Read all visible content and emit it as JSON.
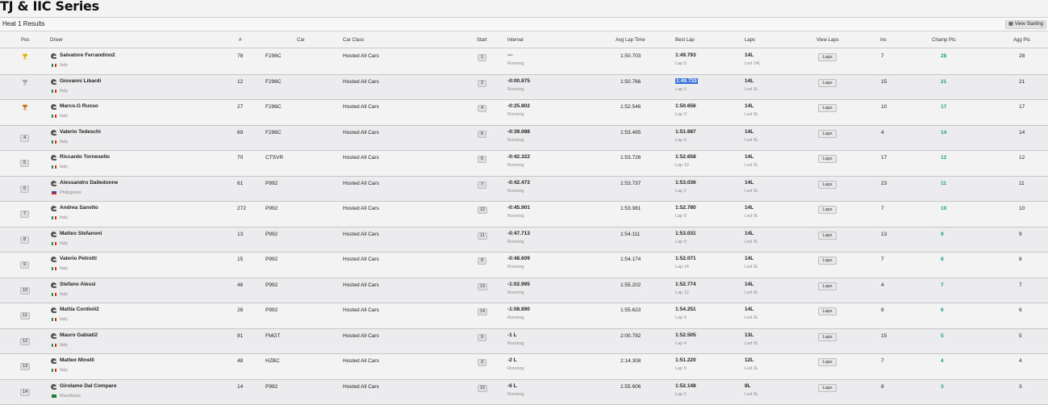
{
  "page": {
    "title": "TJ & IIC Series",
    "heat": "Heat 1 Results",
    "view_starting": "View Starting",
    "laps_button": "Laps"
  },
  "headers": [
    "Pos",
    "Driver",
    "#",
    "Car",
    "Car Class",
    "Start",
    "Interval",
    "Avg Lap Time",
    "Best Lap",
    "Laps",
    "View Laps",
    "Inc",
    "Champ Pts",
    "Agg Pts"
  ],
  "rows": [
    {
      "pos": "1",
      "trophy": "gold",
      "driver": "Salvatore Ferrandino2",
      "flag": "it",
      "country": "Italy",
      "num": "78",
      "car": "F296C",
      "car_class": "Hosted All Cars",
      "start": "1",
      "interval": "---",
      "status": "Running",
      "avg": "1:50.703",
      "best": "1:49.793",
      "best_lap": "Lap 5",
      "laps": "14L",
      "led": "Led 14L",
      "inc": "7",
      "champ": "28",
      "agg": "28"
    },
    {
      "pos": "2",
      "trophy": "silver",
      "driver": "Giovanni Libardi",
      "flag": "it",
      "country": "Italy",
      "num": "12",
      "car": "F296C",
      "car_class": "Hosted All Cars",
      "start": "2",
      "interval": "-0:00.875",
      "status": "Running",
      "avg": "1:50.766",
      "best": "1:49.733",
      "best_lap": "Lap 5",
      "laps": "14L",
      "led": "Led 0L",
      "inc": "15",
      "champ": "21",
      "agg": "21",
      "highlight": true
    },
    {
      "pos": "3",
      "trophy": "bronze",
      "driver": "Marco.G Russo",
      "flag": "it",
      "country": "Italy",
      "num": "27",
      "car": "F296C",
      "car_class": "Hosted All Cars",
      "start": "4",
      "interval": "-0:25.802",
      "status": "Running",
      "avg": "1:52.546",
      "best": "1:50.656",
      "best_lap": "Lap 9",
      "laps": "14L",
      "led": "Led 0L",
      "inc": "10",
      "champ": "17",
      "agg": "17"
    },
    {
      "pos": "4",
      "driver": "Valerio Tedeschi",
      "flag": "it",
      "country": "Italy",
      "num": "69",
      "car": "F296C",
      "car_class": "Hosted All Cars",
      "start": "6",
      "interval": "-0:39.088",
      "status": "Running",
      "avg": "1:53.495",
      "best": "1:51.687",
      "best_lap": "Lap 6",
      "laps": "14L",
      "led": "Led 0L",
      "inc": "4",
      "champ": "14",
      "agg": "14"
    },
    {
      "pos": "5",
      "driver": "Riccardo Tornesello",
      "flag": "it",
      "country": "Italy",
      "num": "70",
      "car": "CTSVR",
      "car_class": "Hosted All Cars",
      "start": "5",
      "interval": "-0:42.322",
      "status": "Running",
      "avg": "1:53.726",
      "best": "1:52.658",
      "best_lap": "Lap 13",
      "laps": "14L",
      "led": "Led 0L",
      "inc": "17",
      "champ": "12",
      "agg": "12"
    },
    {
      "pos": "6",
      "driver": "Alessandro Dalledonne",
      "flag": "ph",
      "country": "Philippines",
      "num": "61",
      "car": "P992",
      "car_class": "Hosted All Cars",
      "start": "7",
      "interval": "-0:42.473",
      "status": "Running",
      "avg": "1:53.737",
      "best": "1:53.036",
      "best_lap": "Lap 2",
      "laps": "14L",
      "led": "Led 0L",
      "inc": "23",
      "champ": "11",
      "agg": "11"
    },
    {
      "pos": "7",
      "driver": "Andrea Sanvito",
      "flag": "it",
      "country": "Italy",
      "num": "272",
      "car": "P992",
      "car_class": "Hosted All Cars",
      "start": "12",
      "interval": "-0:45.901",
      "status": "Running",
      "avg": "1:53.981",
      "best": "1:52.780",
      "best_lap": "Lap 8",
      "laps": "14L",
      "led": "Led 0L",
      "inc": "7",
      "champ": "10",
      "agg": "10"
    },
    {
      "pos": "8",
      "driver": "Matteo Stefanoni",
      "flag": "it",
      "country": "Italy",
      "num": "13",
      "car": "P992",
      "car_class": "Hosted All Cars",
      "start": "11",
      "interval": "-0:47.713",
      "status": "Running",
      "avg": "1:54.111",
      "best": "1:53.031",
      "best_lap": "Lap 9",
      "laps": "14L",
      "led": "Led 0L",
      "inc": "13",
      "champ": "9",
      "agg": "9"
    },
    {
      "pos": "9",
      "driver": "Valerio Petrotti",
      "flag": "it",
      "country": "Italy",
      "num": "15",
      "car": "P992",
      "car_class": "Hosted All Cars",
      "start": "8",
      "interval": "-0:48.609",
      "status": "Running",
      "avg": "1:54.174",
      "best": "1:52.071",
      "best_lap": "Lap 14",
      "laps": "14L",
      "led": "Led 0L",
      "inc": "7",
      "champ": "8",
      "agg": "8"
    },
    {
      "pos": "10",
      "driver": "Stefano Alessi",
      "flag": "it",
      "country": "Italy",
      "num": "46",
      "car": "P992",
      "car_class": "Hosted All Cars",
      "start": "13",
      "interval": "-1:02.995",
      "status": "Running",
      "avg": "1:55.202",
      "best": "1:52.774",
      "best_lap": "Lap 12",
      "laps": "14L",
      "led": "Led 0L",
      "inc": "4",
      "champ": "7",
      "agg": "7"
    },
    {
      "pos": "11",
      "driver": "Mattia Cordioli2",
      "flag": "it",
      "country": "Italy",
      "num": "28",
      "car": "P992",
      "car_class": "Hosted All Cars",
      "start": "14",
      "interval": "-1:08.890",
      "status": "Running",
      "avg": "1:55.623",
      "best": "1:54.251",
      "best_lap": "Lap 4",
      "laps": "14L",
      "led": "Led 0L",
      "inc": "8",
      "champ": "6",
      "agg": "6"
    },
    {
      "pos": "12",
      "driver": "Mauro Gabiati2",
      "flag": "it",
      "country": "Italy",
      "num": "81",
      "car": "FMGT",
      "car_class": "Hosted All Cars",
      "start": "9",
      "interval": "-1 L",
      "status": "Running",
      "avg": "2:00.792",
      "best": "1:52.505",
      "best_lap": "Lap 4",
      "laps": "13L",
      "led": "Led 0L",
      "inc": "15",
      "champ": "5",
      "agg": "5"
    },
    {
      "pos": "13",
      "driver": "Matteo Minelli",
      "flag": "it",
      "country": "Italy",
      "num": "48",
      "car": "HZBC",
      "car_class": "Hosted All Cars",
      "start": "3",
      "interval": "-2 L",
      "status": "Running",
      "avg": "2:14.308",
      "best": "1:51.220",
      "best_lap": "Lap 5",
      "laps": "12L",
      "led": "Led 0L",
      "inc": "7",
      "champ": "4",
      "agg": "4"
    },
    {
      "pos": "14",
      "driver": "Girolamo Dal Compare",
      "flag": "mr",
      "country": "Mauritania",
      "num": "14",
      "car": "P992",
      "car_class": "Hosted All Cars",
      "start": "10",
      "interval": "-6 L",
      "status": "Running",
      "avg": "1:55.606",
      "best": "1:52.148",
      "best_lap": "Lap 5",
      "laps": "8L",
      "led": "Led 0L",
      "inc": "8",
      "champ": "3",
      "agg": "3"
    }
  ]
}
